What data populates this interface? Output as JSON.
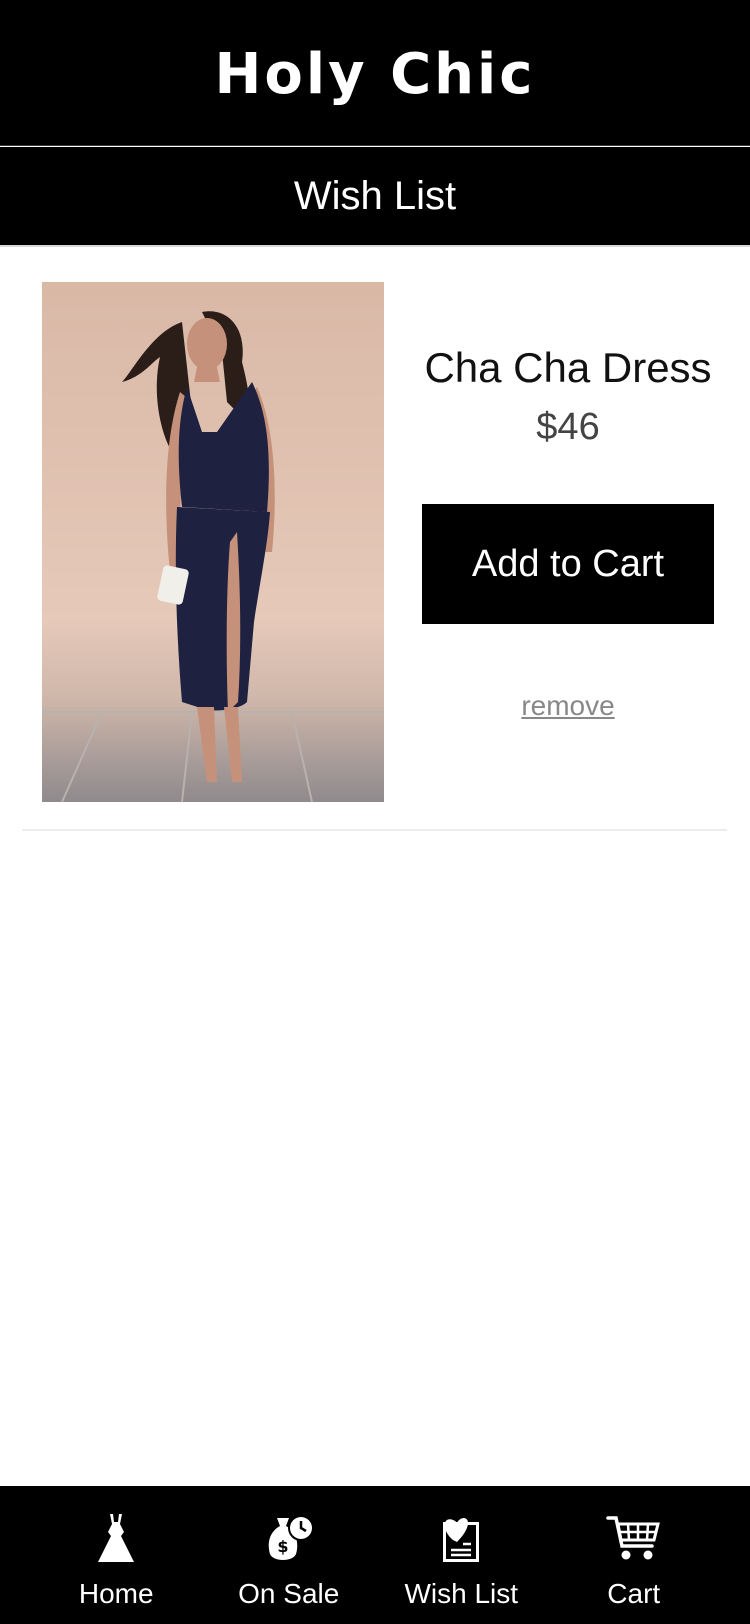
{
  "header": {
    "title": "Holy Chic"
  },
  "subheader": {
    "title": "Wish List"
  },
  "wishlist": {
    "items": [
      {
        "name": "Cha Cha Dress",
        "price": "$46",
        "add_to_cart_label": "Add to Cart",
        "remove_label": "remove"
      }
    ]
  },
  "tabbar": {
    "tabs": [
      {
        "label": "Home",
        "icon": "dress-icon"
      },
      {
        "label": "On Sale",
        "icon": "money-bag-clock-icon"
      },
      {
        "label": "Wish List",
        "icon": "heart-list-icon"
      },
      {
        "label": "Cart",
        "icon": "shopping-cart-icon"
      }
    ]
  },
  "colors": {
    "bars": "#000000",
    "background": "#ffffff",
    "dress": "#1f2140",
    "photo_backdrop": "#dcbfaf"
  }
}
